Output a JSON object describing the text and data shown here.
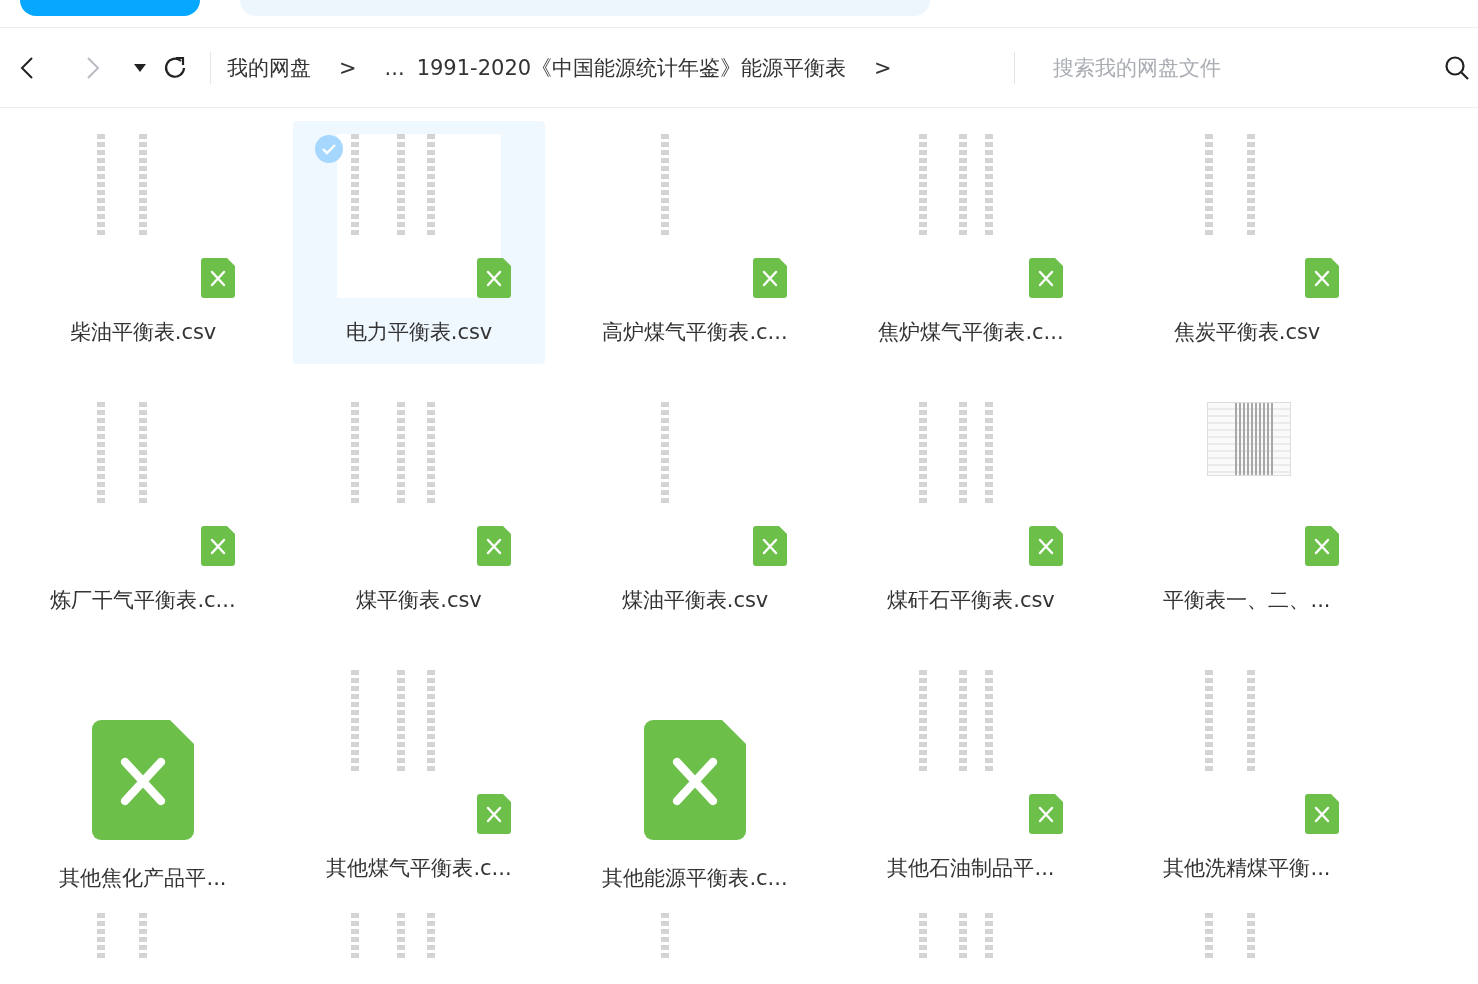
{
  "toolbar": {
    "forward_disabled": true,
    "breadcrumbs": [
      {
        "kind": "link",
        "text": "我的网盘"
      },
      {
        "kind": "sep",
        "text": ">"
      },
      {
        "kind": "link",
        "text": "..."
      },
      {
        "kind": "link",
        "text": "1991-2020《中国能源统计年鉴》能源平衡表"
      },
      {
        "kind": "sep",
        "text": ">"
      }
    ],
    "search": {
      "placeholder": "搜索我的网盘文件"
    }
  },
  "files": [
    {
      "name": "柴油平衡表.csv",
      "kind": "preview",
      "selected": false
    },
    {
      "name": "电力平衡表.csv",
      "kind": "preview",
      "selected": true
    },
    {
      "name": "高炉煤气平衡表.c...",
      "kind": "preview",
      "selected": false
    },
    {
      "name": "焦炉煤气平衡表.c...",
      "kind": "preview",
      "selected": false
    },
    {
      "name": "焦炭平衡表.csv",
      "kind": "preview",
      "selected": false
    },
    {
      "name": "炼厂干气平衡表.c...",
      "kind": "preview",
      "selected": false
    },
    {
      "name": "煤平衡表.csv",
      "kind": "preview",
      "selected": false
    },
    {
      "name": "煤油平衡表.csv",
      "kind": "preview",
      "selected": false
    },
    {
      "name": "煤矸石平衡表.csv",
      "kind": "preview",
      "selected": false
    },
    {
      "name": "平衡表一、二、...",
      "kind": "table",
      "selected": false
    },
    {
      "name": "其他焦化产品平...",
      "kind": "icon",
      "selected": false
    },
    {
      "name": "其他煤气平衡表.c...",
      "kind": "preview",
      "selected": false
    },
    {
      "name": "其他能源平衡表.c...",
      "kind": "icon",
      "selected": false
    },
    {
      "name": "其他石油制品平...",
      "kind": "preview",
      "selected": false
    },
    {
      "name": "其他洗精煤平衡...",
      "kind": "preview",
      "selected": false
    }
  ],
  "partial_row": [
    {
      "kind": "preview"
    },
    {
      "kind": "preview"
    },
    {
      "kind": "preview"
    },
    {
      "kind": "preview"
    },
    {
      "kind": "preview"
    }
  ]
}
